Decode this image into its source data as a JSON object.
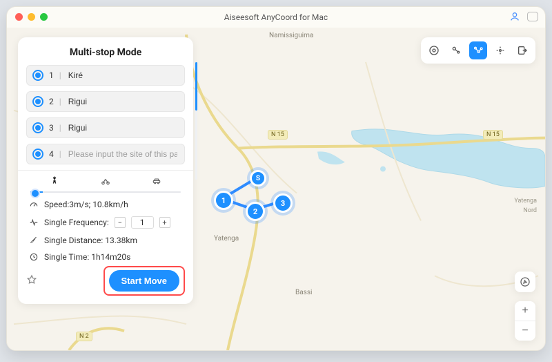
{
  "window": {
    "title": "Aiseesoft AnyCoord for Mac"
  },
  "panel": {
    "title": "Multi-stop Mode",
    "stops": [
      {
        "index": "1",
        "label": "Kiré"
      },
      {
        "index": "2",
        "label": "Rigui"
      },
      {
        "index": "3",
        "label": "Rigui"
      },
      {
        "index": "4",
        "placeholder": "Please input the site of this path"
      }
    ],
    "modes": {
      "walk": "🚶",
      "bike": "🚲",
      "car": "🚘",
      "active": "walk"
    },
    "speed_label": "Speed:3m/s; 10.8km/h",
    "frequency_label": "Single Frequency:",
    "frequency_value": "1",
    "distance_label": "Single Distance: 13.38km",
    "time_label": "Single Time: 1h14m20s",
    "cta": "Start Move"
  },
  "map": {
    "places": {
      "namissiguima": "Namissiguima",
      "yatenga_left": "Yatenga",
      "yatenga_right": "Yatenga",
      "bassi": "Bassi",
      "nord": "Nord"
    },
    "roads": {
      "n15a": "N 15",
      "n15b": "N 15",
      "n2": "N 2"
    },
    "route_nodes": {
      "s": "S",
      "p1": "1",
      "p2": "2",
      "p3": "3"
    },
    "colors": {
      "accent": "#1e90ff",
      "water": "#b6dff0"
    }
  },
  "chips": {
    "items": [
      "locate",
      "point",
      "route",
      "joystick",
      "export"
    ],
    "active_index": 2
  },
  "zoom": {
    "in": "+",
    "out": "−"
  }
}
